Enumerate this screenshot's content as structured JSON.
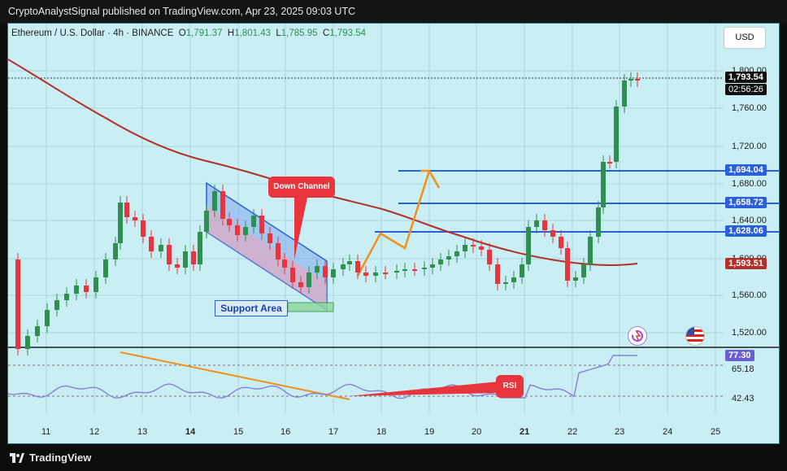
{
  "publisher": "CryptoAnalystSignal published on TradingView.com, Apr 23, 2025 09:03 UTC",
  "legend": {
    "symbol": "Ethereum / U.S. Dollar · 4h · BINANCE",
    "o_label": "O",
    "o": "1,791.37",
    "h_label": "H",
    "h": "1,801.43",
    "l_label": "L",
    "l": "1,785.95",
    "c_label": "C",
    "c": "1,793.54"
  },
  "currency_button": "USD",
  "price_axis": [
    "1,800.00",
    "1,760.00",
    "1,720.00",
    "1,680.00",
    "1,640.00",
    "1,600.00",
    "1,560.00",
    "1,520.00"
  ],
  "price_tags": {
    "current": "1,793.54",
    "countdown": "02:56:26",
    "level1": "1,694.04",
    "level2": "1,658.72",
    "level3": "1,628.06",
    "ma": "1,593.51"
  },
  "time_axis": [
    {
      "label": "11",
      "bold": false
    },
    {
      "label": "12",
      "bold": false
    },
    {
      "label": "13",
      "bold": false
    },
    {
      "label": "14",
      "bold": true
    },
    {
      "label": "15",
      "bold": false
    },
    {
      "label": "16",
      "bold": false
    },
    {
      "label": "17",
      "bold": false
    },
    {
      "label": "18",
      "bold": false
    },
    {
      "label": "19",
      "bold": false
    },
    {
      "label": "20",
      "bold": false
    },
    {
      "label": "21",
      "bold": true
    },
    {
      "label": "22",
      "bold": false
    },
    {
      "label": "23",
      "bold": false
    },
    {
      "label": "24",
      "bold": false
    },
    {
      "label": "25",
      "bold": false
    }
  ],
  "rsi_axis": {
    "current": "77.30",
    "upper": "65.18",
    "lower": "42.43"
  },
  "annotations": {
    "down_channel": "Down Channel",
    "support_area": "Support Area",
    "rsi": "RSI"
  },
  "footer_brand": "TradingView",
  "colors": {
    "background": "#c9eef4",
    "bull": "#2f8f4e",
    "bear": "#e8343c",
    "level_line": "#2b5fd9",
    "ma_line": "#b0302a",
    "projection": "#f2901e",
    "rsi_line": "#8a7fd6"
  },
  "icons": [
    "replay-icon",
    "us-flag-icon",
    "tradingview-logo-icon"
  ]
}
